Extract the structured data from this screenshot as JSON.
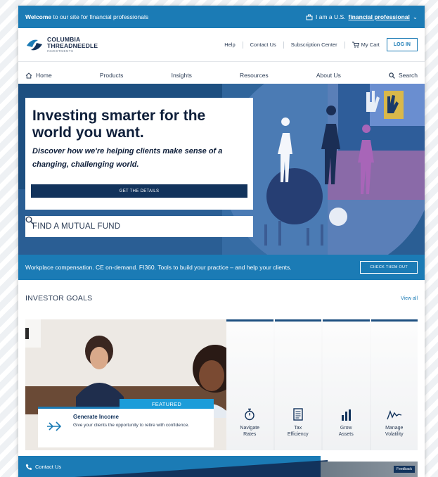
{
  "topbar": {
    "welcome_bold": "Welcome",
    "welcome_text": "to our site for financial professionals",
    "identity_prefix": "I am a U.S.",
    "identity_link": "financial professional",
    "identity_caret": "⌄"
  },
  "header": {
    "brand_line1": "COLUMBIA",
    "brand_line2": "THREADNEEDLE",
    "brand_line3": "INVESTMENTS",
    "help": "Help",
    "contact": "Contact Us",
    "subscription": "Subscription Center",
    "cart": "My Cart",
    "login": "LOG IN"
  },
  "nav": {
    "home": "Home",
    "products": "Products",
    "insights": "Insights",
    "resources": "Resources",
    "about": "About Us",
    "search": "Search"
  },
  "hero": {
    "title": "Investing smarter for the world you want.",
    "subtitle": "Discover how we're helping clients make sense of a changing, challenging world.",
    "cta": "GET THE DETAILS",
    "fund_search": "FIND A MUTUAL FUND"
  },
  "promo": {
    "text": "Workplace compensation. CE on-demand. FI360. Tools to build your practice – and help your clients.",
    "button": "CHECK THEM OUT"
  },
  "goals": {
    "title": "INVESTOR GOALS",
    "view_all": "View all",
    "featured_badge": "FEATURED",
    "featured_title": "Generate Income",
    "featured_desc": "Give your clients the opportunity to retire with confidence.",
    "tiles": [
      {
        "label": "Navigate Rates",
        "icon": "stopwatch-icon"
      },
      {
        "label": "Tax Efficiency",
        "icon": "document-icon"
      },
      {
        "label": "Grow Assets",
        "icon": "bar-chart-icon"
      },
      {
        "label": "Manage Volatility",
        "icon": "wave-icon"
      }
    ]
  },
  "footer": {
    "contact": "Contact Us",
    "feedback": "Feedback"
  },
  "colors": {
    "brand_blue": "#1b7bb5",
    "navy": "#12335c",
    "featured_blue": "#1b9cd9"
  }
}
